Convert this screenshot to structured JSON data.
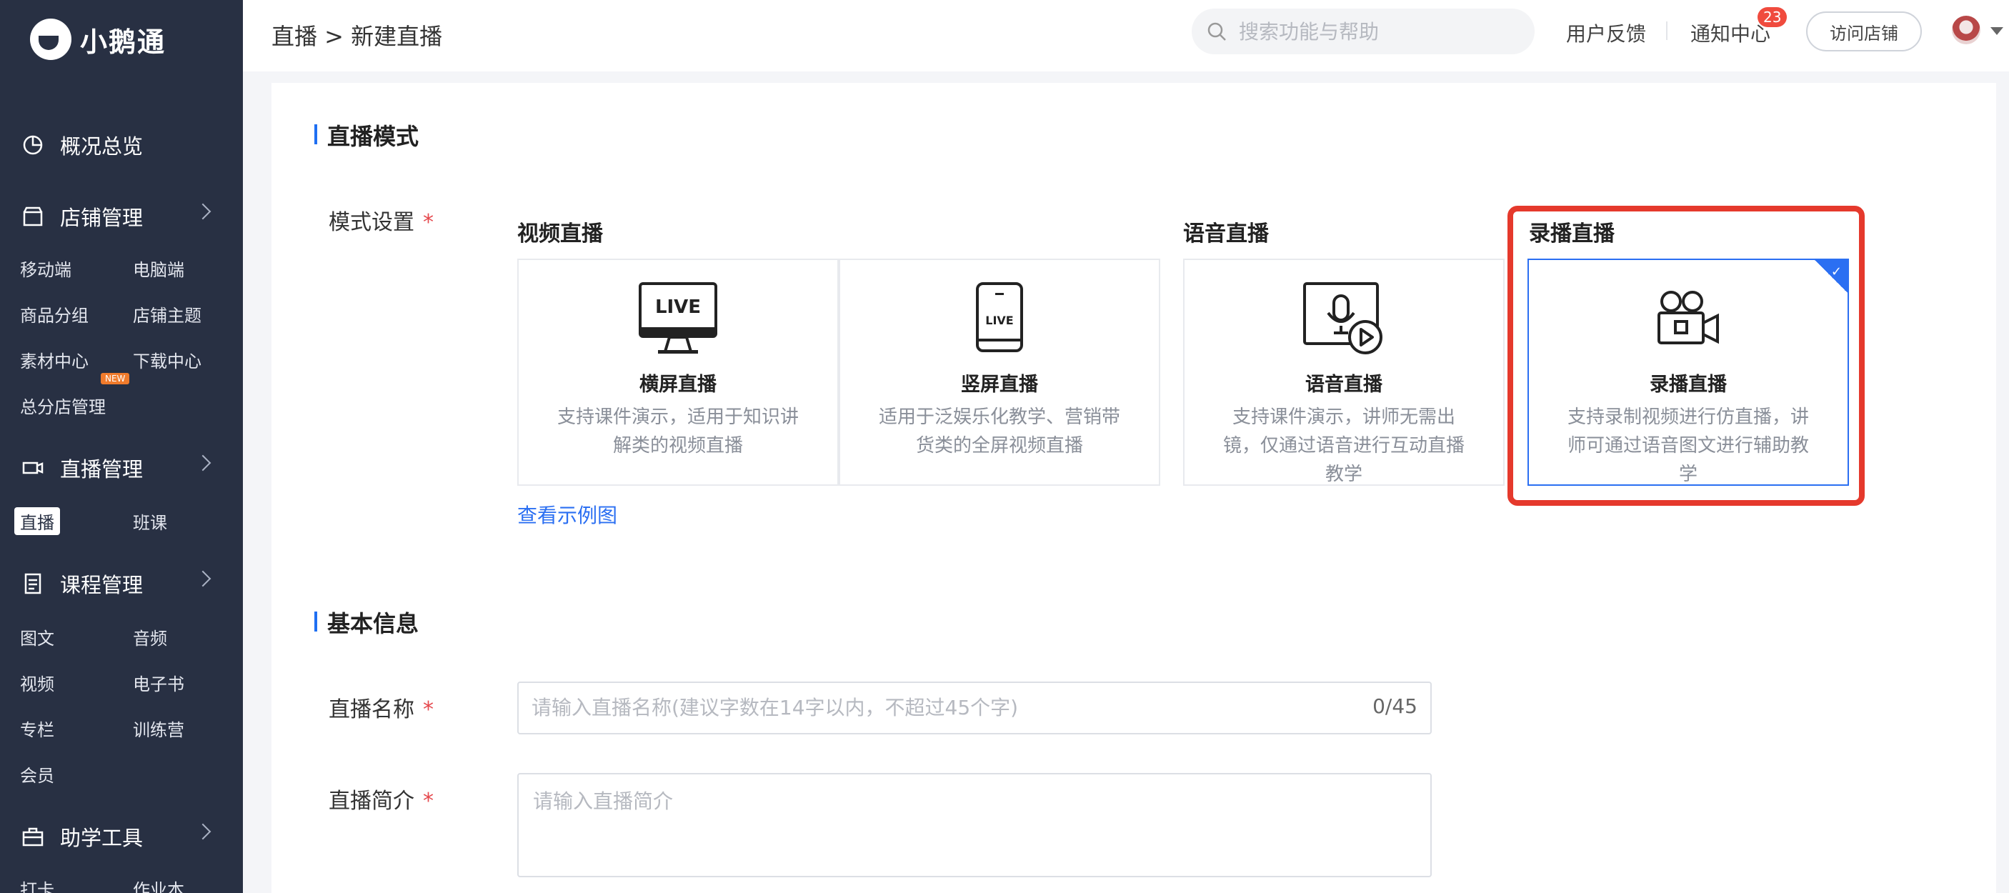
{
  "sidebar": {
    "logo_text": "小鹅通",
    "sections": [
      {
        "label": "概况总览",
        "icon": "pie-chart-icon"
      },
      {
        "label": "店铺管理",
        "icon": "store-icon"
      },
      {
        "label": "直播管理",
        "icon": "video-camera-icon"
      },
      {
        "label": "课程管理",
        "icon": "document-icon"
      },
      {
        "label": "助学工具",
        "icon": "toolbox-icon"
      }
    ],
    "shop_items": [
      "移动端",
      "电脑端",
      "商品分组",
      "店铺主题",
      "素材中心",
      "下载中心",
      "总分店管理"
    ],
    "new_badge": "NEW",
    "live_items": [
      "直播",
      "班课"
    ],
    "course_items": [
      "图文",
      "音频",
      "视频",
      "电子书",
      "专栏",
      "训练营",
      "会员"
    ],
    "tool_items": [
      "打卡",
      "作业本"
    ]
  },
  "header": {
    "breadcrumb": "直播 > 新建直播",
    "search_placeholder": "搜索功能与帮助",
    "feedback": "用户反馈",
    "notifications": "通知中心",
    "notification_count": "23",
    "visit_store": "访问店铺"
  },
  "live_mode": {
    "section_title": "直播模式",
    "field_label": "模式设置",
    "required_mark": "*",
    "groups": {
      "video": "视频直播",
      "audio": "语音直播",
      "recorded": "录播直播"
    },
    "cards": [
      {
        "name": "横屏直播",
        "desc": "支持课件演示，适用于知识讲解类的视频直播",
        "icon_text": "LIVE"
      },
      {
        "name": "竖屏直播",
        "desc": "适用于泛娱乐化教学、营销带货类的全屏视频直播",
        "icon_text": "LIVE"
      },
      {
        "name": "语音直播",
        "desc": "支持课件演示，讲师无需出镜，仅通过语音进行互动直播教学"
      },
      {
        "name": "录播直播",
        "desc": "支持录制视频进行仿直播，讲师可通过语音图文进行辅助教学"
      }
    ],
    "selected": "录播直播",
    "example_link": "查看示例图"
  },
  "basic_info": {
    "section_title": "基本信息",
    "name_label": "直播名称",
    "name_placeholder": "请输入直播名称(建议字数在14字以内，不超过45个字)",
    "name_counter": "0/45",
    "intro_label": "直播简介",
    "intro_placeholder": "请输入直播简介",
    "required_mark": "*"
  },
  "colors": {
    "sidebar_bg": "#283043",
    "accent": "#2b6ff2",
    "highlight": "#e5392c",
    "required": "#e5484d"
  }
}
